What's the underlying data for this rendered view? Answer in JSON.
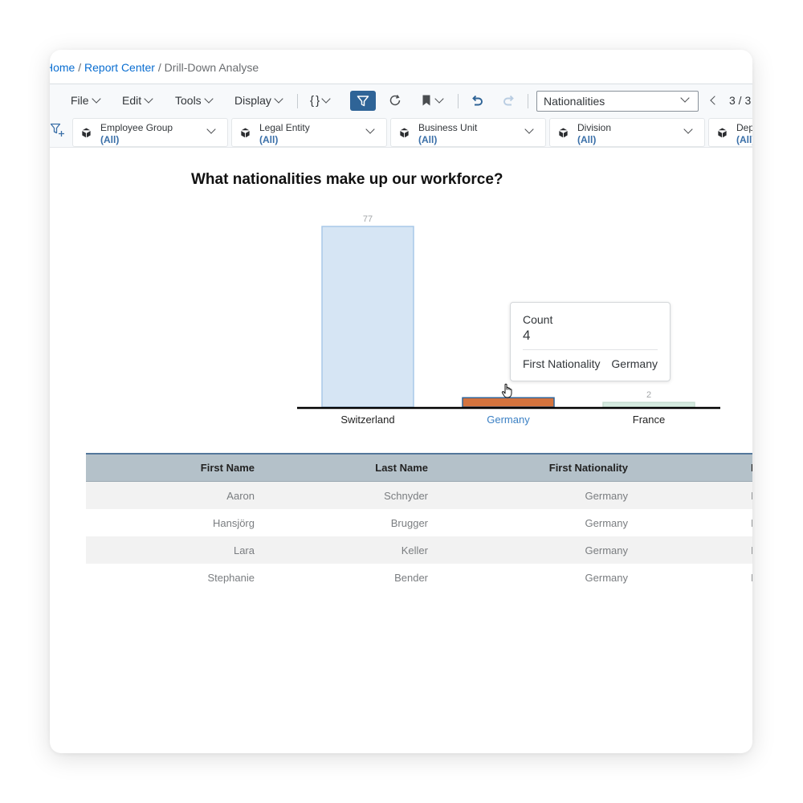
{
  "breadcrumb": {
    "home": "Home",
    "sep1": "/",
    "report_center": "Report Center",
    "sep2": "/",
    "current": "Drill-Down Analyse"
  },
  "toolbar": {
    "menus": [
      "File",
      "Edit",
      "Tools",
      "Display"
    ],
    "braces_icon": "{ }",
    "select_value": "Nationalities",
    "page_indicator": "3 / 3",
    "accent_color": "#2f6497",
    "icons": [
      "filter-icon",
      "refresh-icon",
      "bookmark-icon",
      "undo-icon",
      "redo-icon",
      "chevron-left-icon"
    ]
  },
  "filters": [
    {
      "label": "Employee Group",
      "value": "(All)"
    },
    {
      "label": "Legal Entity",
      "value": "(All)"
    },
    {
      "label": "Business Unit",
      "value": "(All)"
    },
    {
      "label": "Division",
      "value": "(All)"
    },
    {
      "label": "Department",
      "value": "(All)"
    }
  ],
  "chart": {
    "title": "What nationalities make up our workforce?"
  },
  "chart_data": {
    "type": "bar",
    "title": "What nationalities make up our workforce?",
    "categories": [
      "Switzerland",
      "Germany",
      "France"
    ],
    "values": [
      77,
      4,
      2
    ],
    "data_labels": [
      "77",
      "",
      "2"
    ],
    "selected_category": "Germany",
    "colors": {
      "default": "#d6e5f4",
      "selected": "#d4733e",
      "other": "#d5ebe0",
      "selected_label": "#3b80c4"
    },
    "ylim": [
      0,
      77
    ]
  },
  "tooltip": {
    "measure_label": "Count",
    "measure_value": "4",
    "dimension_label": "First Nationality",
    "dimension_value": "Germany"
  },
  "table": {
    "headers": [
      "First Name",
      "Last Name",
      "First Nationality",
      "L"
    ],
    "rows": [
      [
        "Aaron",
        "Schnyder",
        "Germany",
        "I"
      ],
      [
        "Hansjörg",
        "Brugger",
        "Germany",
        "I"
      ],
      [
        "Lara",
        "Keller",
        "Germany",
        "I"
      ],
      [
        "Stephanie",
        "Bender",
        "Germany",
        "I"
      ]
    ]
  }
}
